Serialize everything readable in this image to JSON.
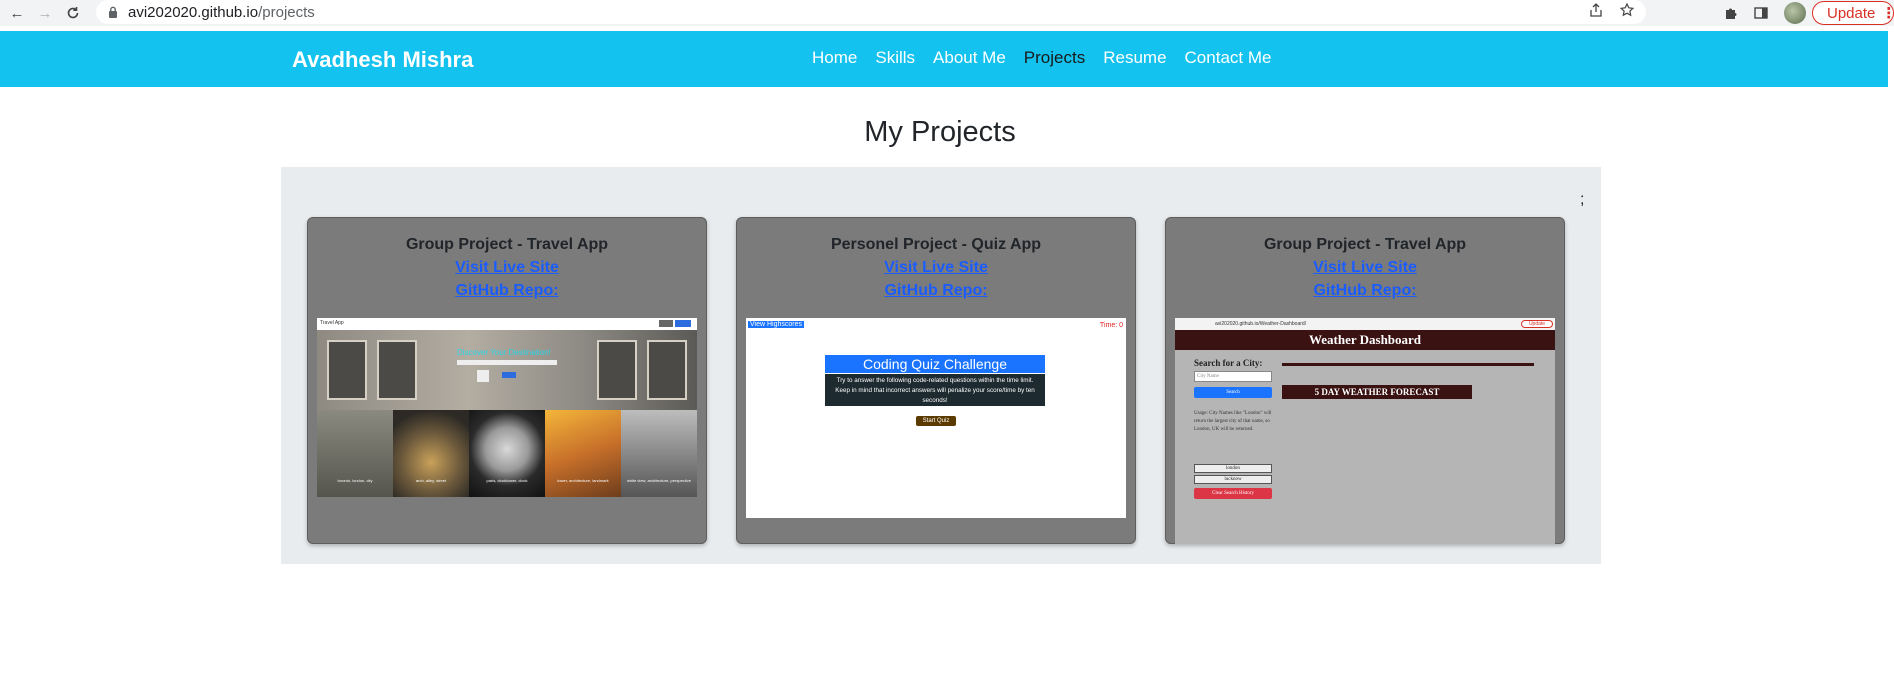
{
  "browser": {
    "url_host": "avi202020.github.io",
    "url_path": "/projects",
    "update_label": "Update",
    "update_menu": "⋮"
  },
  "navbar": {
    "brand": "Avadhesh Mishra",
    "items": [
      {
        "label": "Home"
      },
      {
        "label": "Skills"
      },
      {
        "label": "About Me"
      },
      {
        "label": "Projects"
      },
      {
        "label": "Resume"
      },
      {
        "label": "Contact Me"
      }
    ],
    "active_item": "Projects",
    "bg_color": "#13c2ee"
  },
  "page": {
    "title": "My Projects",
    "stray_text": ";"
  },
  "projects": [
    {
      "title": "Group Project - Travel App",
      "live_label": "Visit Live Site",
      "repo_label": "GitHub Repo:",
      "thumb": {
        "nav_title": "Travel App",
        "hero_text": "Discover Your Destination!",
        "captions": [
          "toronto, london, city",
          "arch, alley, street",
          "paris, clocktower, clock",
          "tower, architecture, landmark",
          "white view, architecture, perspective"
        ]
      }
    },
    {
      "title": "Personel Project - Quiz App",
      "live_label": "Visit Live Site",
      "repo_label": "GitHub Repo:",
      "thumb": {
        "highscores": "View Highscores",
        "time": "Time: 0",
        "heading": "Coding Quiz Challenge",
        "description": "Try to answer the following code-related questions within the time limit. Keep in mind that incorrect answers will penalize your score/time by ten seconds!",
        "start": "Start Quiz"
      }
    },
    {
      "title": "Group Project - Travel App",
      "live_label": "Visit Live Site",
      "repo_label": "GitHub Repo:",
      "thumb": {
        "url": "avi202020.github.io/Weather-Dashboard/",
        "update": "Update",
        "heading": "Weather Dashboard",
        "search_label": "Search for a City:",
        "search_placeholder": "City Name",
        "search_button": "Search",
        "usage": "Usage: City Names like \"London\" will return the largest city of that name, so London, UK will be returned.",
        "history": [
          "london",
          "lucknow"
        ],
        "clear": "Clear Search History",
        "forecast": "5 DAY WEATHER FORECAST"
      }
    }
  ]
}
